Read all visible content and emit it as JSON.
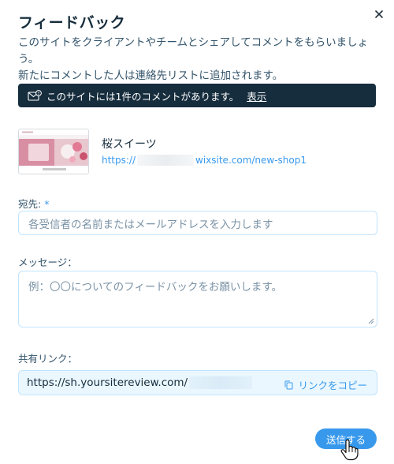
{
  "dialog": {
    "title": "フィードバック",
    "description_line1": "このサイトをクライアントやチームとシェアしてコメントをもらいましょう。",
    "description_line2": "新たにコメントした人は連絡先リストに追加されます。"
  },
  "notice": {
    "text": "このサイトには1件のコメントがあります。",
    "link": "表示",
    "icon": "envelope-icon"
  },
  "site": {
    "name": "桜スイーツ",
    "url_prefix": "https://",
    "url_suffix": "wixsite.com/new-shop1"
  },
  "recipients": {
    "label": "宛先:",
    "required_mark": "*",
    "placeholder": "各受信者の名前またはメールアドレスを入力します"
  },
  "message": {
    "label": "メッセージ：",
    "placeholder": "例：〇〇についてのフィードバックをお願いします。"
  },
  "share_link": {
    "label": "共有リンク：",
    "url": "https://sh.yoursitereview.com/",
    "copy_label": "リンクをコピー",
    "copy_icon": "copy-icon"
  },
  "actions": {
    "send_label": "送信する"
  },
  "colors": {
    "accent": "#3899ec",
    "notice_bg": "#162d3d",
    "input_border": "#c1e4fe",
    "share_bg": "#eaf7ff"
  }
}
